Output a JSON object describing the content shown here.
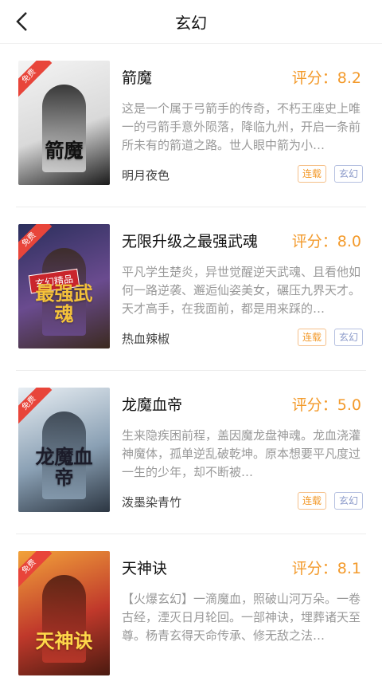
{
  "header": {
    "title": "玄幻",
    "back_icon": "chevron-left-icon"
  },
  "tags": {
    "serial": "连载",
    "genre": "玄幻"
  },
  "cover_ribbon": "免费",
  "books": [
    {
      "name": "箭魔",
      "score": "评分：8.2",
      "desc": "这是一个属于弓箭手的传奇，不朽王座史上唯一的弓箭手意外陨落，降临九州，开启一条前所未有的箭道之路。世人眼中箭为小…",
      "author": "明月夜色",
      "cover_colors": [
        "#f4f4f4",
        "#d9d9d9",
        "#1a1a1a"
      ],
      "cover_title": "箭魔",
      "cover_title_color": "#111111"
    },
    {
      "name": "无限升级之最强武魂",
      "score": "评分：8.0",
      "desc": "平凡学生楚炎，异世觉醒逆天武魂、且看他如何一路逆袭、邂逅仙姿美女，碾压九界天才。天才高手，在我面前，都是用来踩的…",
      "author": "热血辣椒",
      "cover_colors": [
        "#2b2f5c",
        "#6a4b8f",
        "#3b2a1f"
      ],
      "cover_title": "最强武魂",
      "cover_title_color": "#f4c23a",
      "cover_badge": "玄幻精品"
    },
    {
      "name": "龙魔血帝",
      "score": "评分：5.0",
      "desc": "生来隐疾困前程，盖因魔龙盘神魂。龙血浇灌神魔体，孤单逆乱破乾坤。原本想要平凡度过一生的少年，却不断被…",
      "author": "泼墨染青竹",
      "cover_colors": [
        "#e8eef3",
        "#8aa0b4",
        "#2c3642"
      ],
      "cover_title": "龙魔血帝",
      "cover_title_color": "#1c1c2a"
    },
    {
      "name": "天神诀",
      "score": "评分：8.1",
      "desc": "【火爆玄幻】一滴魔血，照破山河万朵。一卷古经，湮灭日月轮回。一部神诀，埋葬诸天至尊。杨青玄得天命传承、修无敌之法…",
      "author": "",
      "cover_colors": [
        "#f2a23a",
        "#c0392b",
        "#4a1a10"
      ],
      "cover_title": "天神诀",
      "cover_title_color": "#ffd84a"
    }
  ]
}
